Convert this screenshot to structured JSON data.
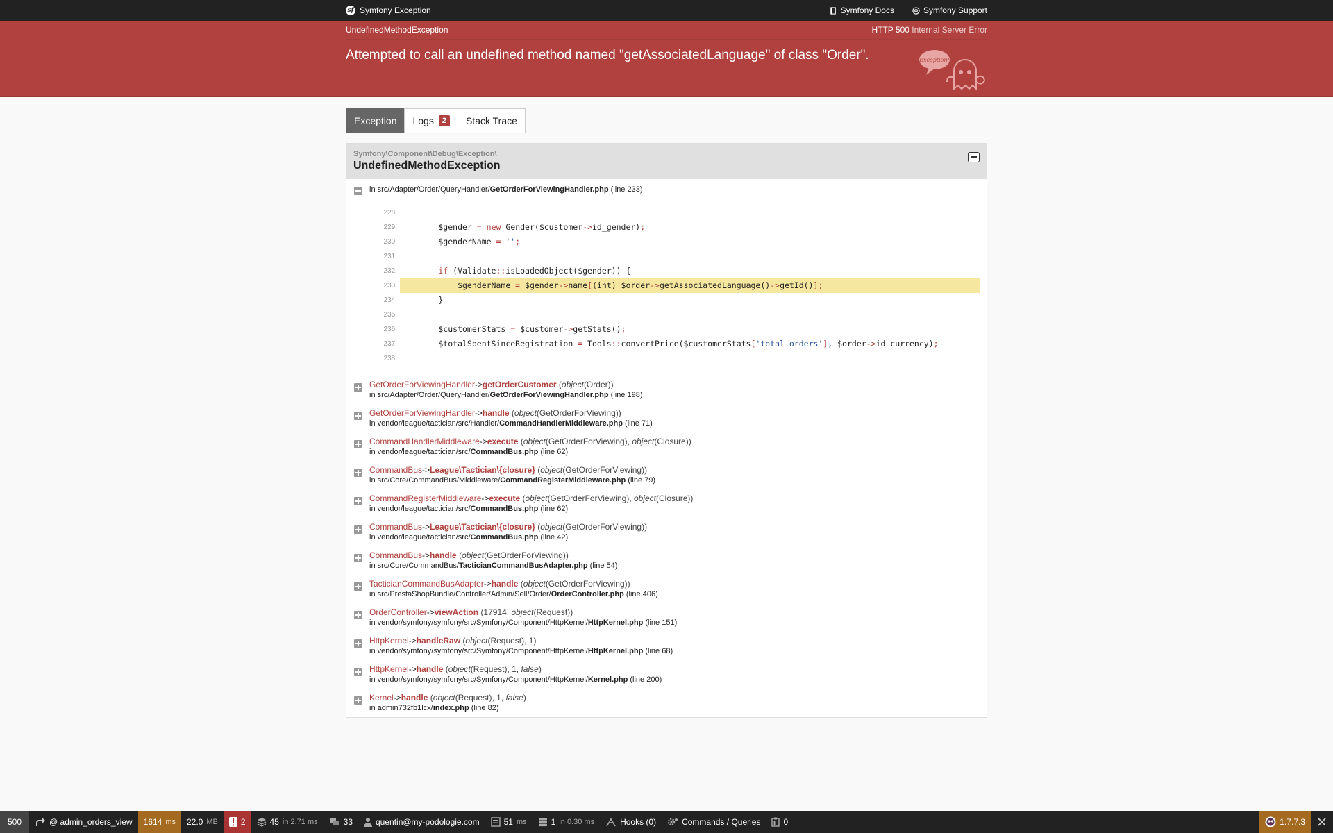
{
  "topbar": {
    "brand": "Symfony Exception",
    "docs": "Symfony Docs",
    "support": "Symfony Support"
  },
  "exception": {
    "class_short": "UndefinedMethodException",
    "http_code": "HTTP 500",
    "http_text": "Internal Server Error",
    "message": "Attempted to call an undefined method named \"getAssociatedLanguage\" of class \"Order\".",
    "ghost_text": "Exception!"
  },
  "tabs": {
    "exception": "Exception",
    "logs": "Logs",
    "logs_count": "2",
    "stack": "Stack Trace"
  },
  "panel": {
    "namespace": "Symfony\\Component\\Debug\\Exception\\",
    "class": "UndefinedMethodException",
    "first_loc_prefix": "in src/Adapter/Order/QueryHandler/",
    "first_loc_file": "GetOrderForViewingHandler.php",
    "first_loc_line": "(line 233)"
  },
  "code": [
    {
      "n": "228.",
      "html": ""
    },
    {
      "n": "229.",
      "html": "        $gender <span class='kw'>=</span> <span class='kw'>new</span> Gender($customer<span class='kw'>-&gt;</span>id_gender)<span class='kw'>;</span>"
    },
    {
      "n": "230.",
      "html": "        $genderName <span class='kw'>=</span> <span class='str'>''</span><span class='kw'>;</span>"
    },
    {
      "n": "231.",
      "html": ""
    },
    {
      "n": "232.",
      "html": "        <span class='kw'>if</span> (Validate<span class='kw'>::</span>isLoadedObject($gender)) {"
    },
    {
      "n": "233.",
      "html": "            $genderName <span class='kw'>=</span> $gender<span class='kw'>-&gt;</span>name<span class='kw'>[</span>(int) $order<span class='kw'>-&gt;</span>getAssociatedLanguage()<span class='kw'>-&gt;</span>getId()<span class='kw'>];</span>",
      "hl": true
    },
    {
      "n": "234.",
      "html": "        }"
    },
    {
      "n": "235.",
      "html": ""
    },
    {
      "n": "236.",
      "html": "        $customerStats <span class='kw'>=</span> $customer<span class='kw'>-&gt;</span>getStats()<span class='kw'>;</span>"
    },
    {
      "n": "237.",
      "html": "        $totalSpentSinceRegistration <span class='kw'>=</span> Tools<span class='kw'>::</span>convertPrice($customerStats<span class='kw'>[</span><span class='str'>'total_orders'</span><span class='kw'>]</span>, $order<span class='kw'>-&gt;</span>id_currency)<span class='kw'>;</span>"
    },
    {
      "n": "238.",
      "html": ""
    }
  ],
  "frames": [
    {
      "cls": "GetOrderForViewingHandler",
      "fn": "getOrderCustomer",
      "args": "(<em>object</em>(Order))",
      "path": "in src/Adapter/Order/QueryHandler/",
      "file": "GetOrderForViewingHandler.php",
      "line": "(line 198)"
    },
    {
      "cls": "GetOrderForViewingHandler",
      "fn": "handle",
      "args": "(<em>object</em>(GetOrderForViewing))",
      "path": "in vendor/league/tactician/src/Handler/",
      "file": "CommandHandlerMiddleware.php",
      "line": "(line 71)"
    },
    {
      "cls": "CommandHandlerMiddleware",
      "fn": "execute",
      "args": "(<em>object</em>(GetOrderForViewing), <em>object</em>(Closure))",
      "path": "in vendor/league/tactician/src/",
      "file": "CommandBus.php",
      "line": "(line 62)"
    },
    {
      "cls": "CommandBus",
      "fn": "League\\Tactician\\{closure}",
      "args": "(<em>object</em>(GetOrderForViewing))",
      "path": "in src/Core/CommandBus/Middleware/",
      "file": "CommandRegisterMiddleware.php",
      "line": "(line 79)"
    },
    {
      "cls": "CommandRegisterMiddleware",
      "fn": "execute",
      "args": "(<em>object</em>(GetOrderForViewing), <em>object</em>(Closure))",
      "path": "in vendor/league/tactician/src/",
      "file": "CommandBus.php",
      "line": "(line 62)"
    },
    {
      "cls": "CommandBus",
      "fn": "League\\Tactician\\{closure}",
      "args": "(<em>object</em>(GetOrderForViewing))",
      "path": "in vendor/league/tactician/src/",
      "file": "CommandBus.php",
      "line": "(line 42)"
    },
    {
      "cls": "CommandBus",
      "fn": "handle",
      "args": "(<em>object</em>(GetOrderForViewing))",
      "path": "in src/Core/CommandBus/",
      "file": "TacticianCommandBusAdapter.php",
      "line": "(line 54)"
    },
    {
      "cls": "TacticianCommandBusAdapter",
      "fn": "handle",
      "args": "(<em>object</em>(GetOrderForViewing))",
      "path": "in src/PrestaShopBundle/Controller/Admin/Sell/Order/",
      "file": "OrderController.php",
      "line": "(line 406)"
    },
    {
      "cls": "OrderController",
      "fn": "viewAction",
      "args": "(17914, <em>object</em>(Request))",
      "path": "in vendor/symfony/symfony/src/Symfony/Component/HttpKernel/",
      "file": "HttpKernel.php",
      "line": "(line 151)"
    },
    {
      "cls": "HttpKernel",
      "fn": "handleRaw",
      "args": "(<em>object</em>(Request), 1)",
      "path": "in vendor/symfony/symfony/src/Symfony/Component/HttpKernel/",
      "file": "HttpKernel.php",
      "line": "(line 68)"
    },
    {
      "cls": "HttpKernel",
      "fn": "handle",
      "args": "(<em>object</em>(Request), 1, <em>false</em>)",
      "path": "in vendor/symfony/symfony/src/Symfony/Component/HttpKernel/",
      "file": "Kernel.php",
      "line": "(line 200)"
    },
    {
      "cls": "Kernel",
      "fn": "handle",
      "args": "(<em>object</em>(Request), 1, <em>false</em>)",
      "path": "in admin732fb1lcx/",
      "file": "index.php",
      "line": "(line 82)"
    }
  ],
  "toolbar": {
    "status": "500",
    "route": "@ admin_orders_view",
    "time_value": "1614",
    "time_unit": "ms",
    "mem_value": "22.0",
    "mem_unit": "MB",
    "errors": "2",
    "logs_value": "45",
    "logs_unit": "in 2.71 ms",
    "translations": "33",
    "user": "quentin@my-podologie.com",
    "forms_value": "51",
    "forms_unit": "ms",
    "db_value": "1",
    "db_unit": "in 0.30 ms",
    "hooks": "Hooks (0)",
    "commands": "Commands / Queries",
    "cache": "0",
    "version": "1.7.7.3"
  },
  "colors": {
    "header_red": "#b0413e",
    "highlight": "#f6e7a0",
    "toolbar_bg": "#222222",
    "time_amber": "#a46a1f"
  }
}
